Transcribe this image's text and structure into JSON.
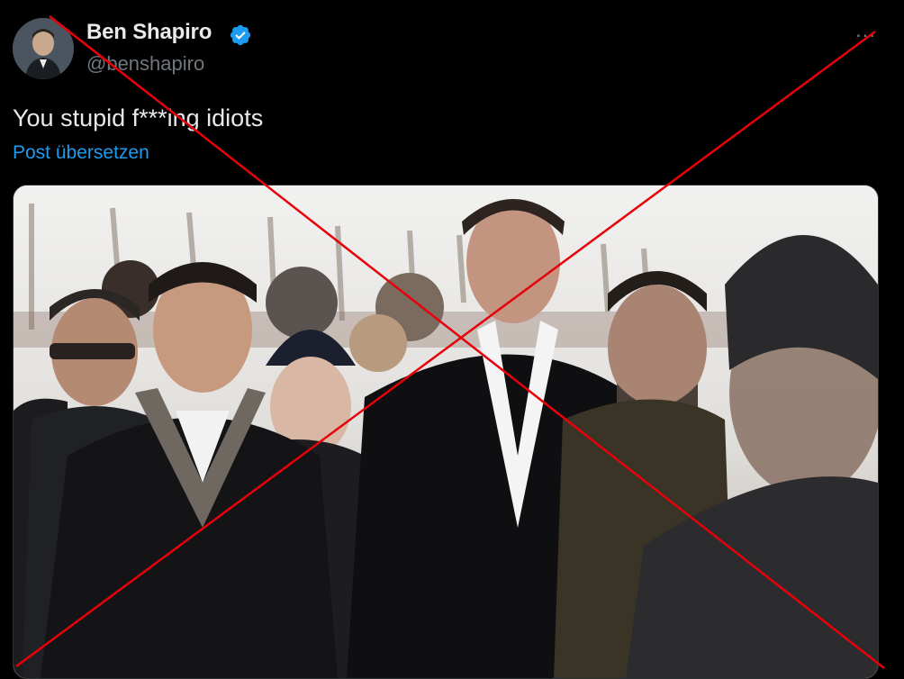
{
  "post": {
    "author": {
      "name": "Ben Shapiro",
      "handle": "@benshapiro",
      "verified": true,
      "verified_icon": "verified-badge-icon",
      "avatar_icon": "avatar-photo"
    },
    "more_icon": "…",
    "text": "You stupid f***ing idiots",
    "translate_label": "Post übersetzen",
    "media": {
      "type": "photo",
      "icon": "photo-image"
    }
  },
  "overlay": {
    "type": "red-x-cross",
    "color": "#e8000b"
  },
  "colors": {
    "background": "#000000",
    "text": "#e7e9ea",
    "secondary": "#71767b",
    "link": "#1d9bf0",
    "verified": "#1d9bf0"
  }
}
